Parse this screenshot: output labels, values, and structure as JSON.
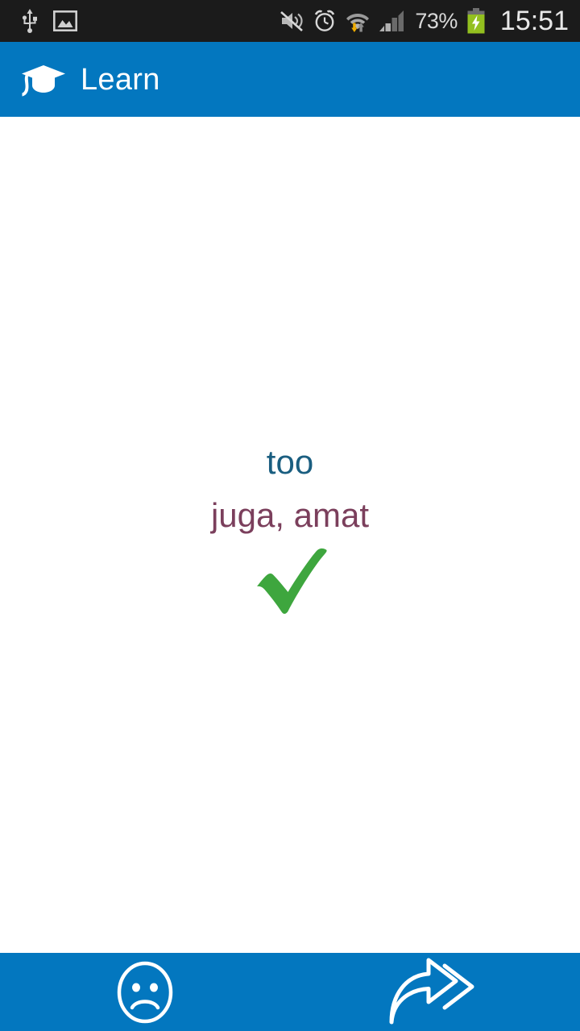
{
  "status_bar": {
    "background": "#1b1b1b",
    "left_icons": [
      {
        "name": "usb-icon",
        "label": "USB connected"
      },
      {
        "name": "screenshot-image-icon",
        "label": "Screenshot captured"
      }
    ],
    "right_icons": [
      {
        "name": "volume-muted-icon",
        "label": "Sound muted"
      },
      {
        "name": "alarm-clock-icon",
        "label": "Alarm set"
      },
      {
        "name": "wifi-transfer-icon",
        "label": "Wi-Fi connected, data transfer"
      },
      {
        "name": "cellular-signal-icon",
        "label": "Cellular signal",
        "bars_filled": 2,
        "bars_total": 4
      }
    ],
    "battery_percent": "73%",
    "battery_charging": true,
    "battery_color": "#93c01f",
    "clock": "15:51"
  },
  "app_bar": {
    "title": "Learn",
    "icon": "graduation-cap-icon",
    "background": "#0377bf",
    "text_color": "#ffffff"
  },
  "card": {
    "term": "too",
    "term_color": "#1a5e80",
    "translation": "juga, amat",
    "translation_color": "#7b3f5c",
    "result": "correct",
    "result_icon": "green-check-icon",
    "result_color": "#3ea63e"
  },
  "bottom_bar": {
    "background": "#0377bf",
    "buttons": [
      {
        "name": "mark-wrong-button",
        "icon": "sad-face-icon",
        "label": "I got it wrong"
      },
      {
        "name": "next-card-button",
        "icon": "forward-arrow-icon",
        "label": "Next"
      }
    ]
  }
}
